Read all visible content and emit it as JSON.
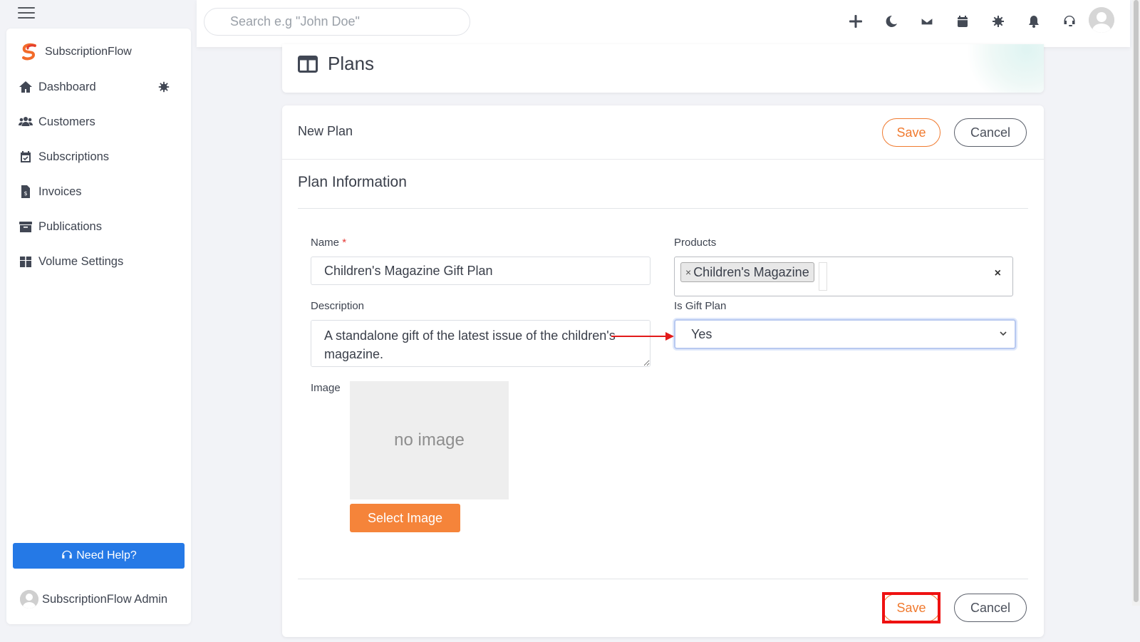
{
  "topbar": {
    "search_placeholder": "Search e.g \"John Doe\"",
    "icons": [
      "plus-icon",
      "moon-icon",
      "envelope-icon",
      "calendar-icon",
      "gear-icon",
      "bell-icon",
      "headset-icon"
    ]
  },
  "sidebar": {
    "brand": "SubscriptionFlow",
    "items": [
      {
        "label": "Dashboard",
        "icon": "home-icon"
      },
      {
        "label": "Customers",
        "icon": "users-icon"
      },
      {
        "label": "Subscriptions",
        "icon": "calendar-check-icon"
      },
      {
        "label": "Invoices",
        "icon": "invoice-icon"
      },
      {
        "label": "Publications",
        "icon": "archive-icon"
      },
      {
        "label": "Volume Settings",
        "icon": "box-icon"
      }
    ],
    "help_label": "Need Help?",
    "admin_name": "SubscriptionFlow Admin"
  },
  "page": {
    "title": "Plans"
  },
  "form": {
    "header_title": "New Plan",
    "save_label": "Save",
    "cancel_label": "Cancel",
    "section_title": "Plan Information",
    "name_label": "Name",
    "name_required": "*",
    "name_value": "Children's Magazine Gift Plan",
    "products_label": "Products",
    "product_tag": "Children's Magazine",
    "tag_remove": "×",
    "products_clear": "×",
    "description_label": "Description",
    "description_value": "A standalone gift of the latest issue of the children's magazine.",
    "gift_label": "Is Gift Plan",
    "gift_value": "Yes",
    "image_label": "Image",
    "no_image_text": "no image",
    "select_image_label": "Select Image"
  },
  "colors": {
    "accent_orange": "#f5843a",
    "help_blue": "#2579e6",
    "annotation_red": "#ee1111"
  }
}
